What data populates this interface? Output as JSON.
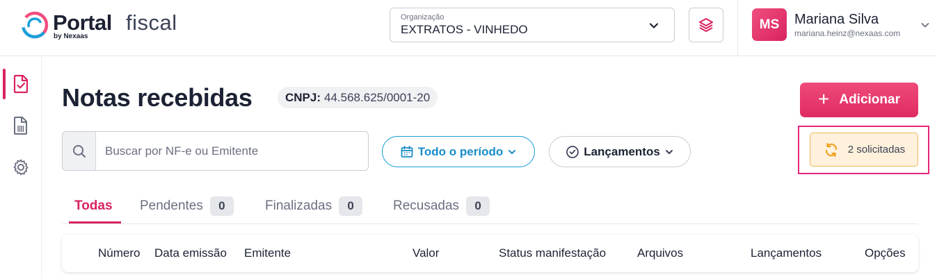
{
  "header": {
    "logo": {
      "brand": "Portal",
      "product": "fiscal",
      "byline": "by Nexaas"
    },
    "organization": {
      "label": "Organização",
      "value": "EXTRATOS - VINHEDO"
    },
    "user": {
      "initials": "MS",
      "name": "Mariana Silva",
      "email": "mariana.heinz@nexaas.com"
    }
  },
  "sidebar": {
    "items": [
      {
        "icon": "invoice-check-icon",
        "active": true
      },
      {
        "icon": "barcode-document-icon",
        "active": false
      },
      {
        "icon": "gear-icon",
        "active": false
      }
    ]
  },
  "page": {
    "title": "Notas recebidas",
    "cnpj_label": "CNPJ:",
    "cnpj_value": "44.568.625/0001-20",
    "add_label": "Adicionar"
  },
  "filters": {
    "search_placeholder": "Buscar por NF-e ou Emitente",
    "period_label": "Todo o período",
    "launches_label": "Lançamentos",
    "requests_label": "2 solicitadas"
  },
  "tabs": [
    {
      "label": "Todas",
      "count": null,
      "active": true
    },
    {
      "label": "Pendentes",
      "count": "0",
      "active": false
    },
    {
      "label": "Finalizadas",
      "count": "0",
      "active": false
    },
    {
      "label": "Recusadas",
      "count": "0",
      "active": false
    }
  ],
  "table": {
    "columns": [
      "Número",
      "Data emissão",
      "Emitente",
      "Valor",
      "Status manifestação",
      "Arquivos",
      "Lançamentos",
      "Opções"
    ]
  },
  "colors": {
    "accent": "#d9235f",
    "period_blue": "#1a8cc8",
    "requests_bg": "#fff1dc",
    "highlight": "#e5267a"
  }
}
